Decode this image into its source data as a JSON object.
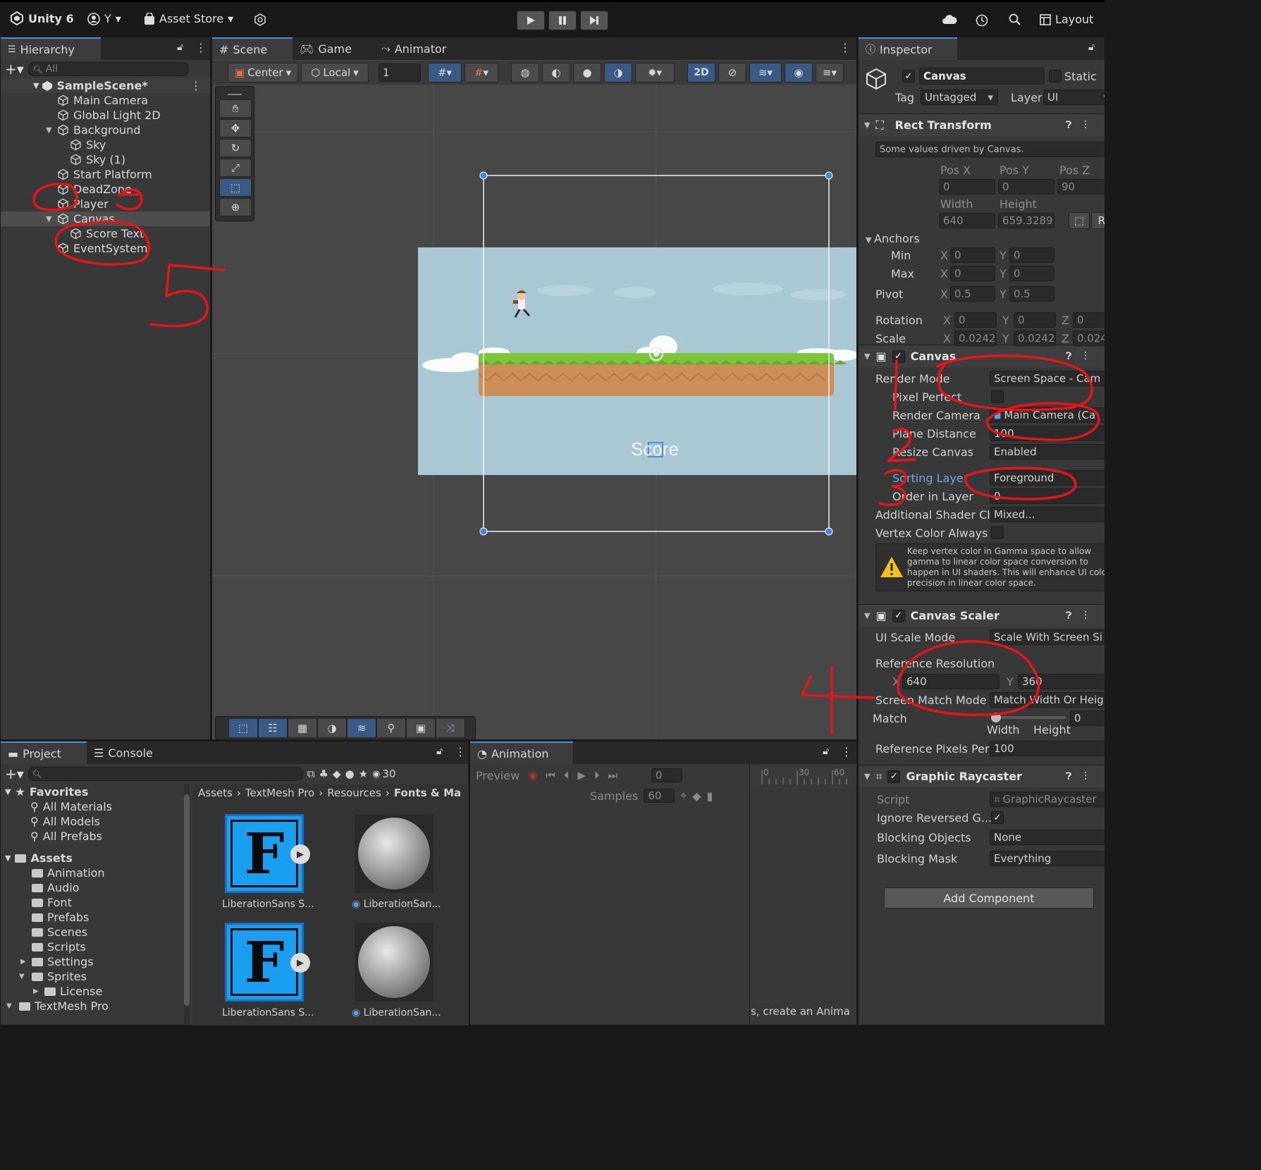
{
  "topbar": {
    "app_name": "Unity 6",
    "account": "Y",
    "asset_store": "Asset Store",
    "layout": "Layout"
  },
  "hierarchy": {
    "tab": "Hierarchy",
    "search_placeholder": "All",
    "scene": "SampleScene*",
    "items": [
      {
        "label": "Main Camera",
        "indent": 1
      },
      {
        "label": "Global Light 2D",
        "indent": 1
      },
      {
        "label": "Background",
        "indent": 1,
        "expanded": true
      },
      {
        "label": "Sky",
        "indent": 2
      },
      {
        "label": "Sky (1)",
        "indent": 2
      },
      {
        "label": "Start Platform",
        "indent": 1
      },
      {
        "label": "DeadZone",
        "indent": 1
      },
      {
        "label": "Player",
        "indent": 1
      },
      {
        "label": "Canvas",
        "indent": 1,
        "expanded": true,
        "selected": true
      },
      {
        "label": "Score Text",
        "indent": 2
      },
      {
        "label": "EventSystem",
        "indent": 1
      }
    ]
  },
  "scene_view": {
    "tabs": [
      "Scene",
      "Game",
      "Animator"
    ],
    "pivot": "Center",
    "space": "Local",
    "grid_value": "1",
    "mode_2d": "2D",
    "score_label": "Score"
  },
  "inspector": {
    "tab": "Inspector",
    "object_name": "Canvas",
    "static_label": "Static",
    "tag_label": "Tag",
    "tag_value": "Untagged",
    "layer_label": "Layer",
    "layer_value": "UI",
    "rect_transform": {
      "title": "Rect Transform",
      "note": "Some values driven by Canvas.",
      "pos_x_label": "Pos X",
      "pos_y_label": "Pos Y",
      "pos_z_label": "Pos Z",
      "pos_x": "0",
      "pos_y": "0",
      "pos_z": "90",
      "width_label": "Width",
      "height_label": "Height",
      "width": "640",
      "height": "659.3289",
      "anchors_label": "Anchors",
      "min_label": "Min",
      "max_label": "Max",
      "pivot_label": "Pivot",
      "min_x": "0",
      "min_y": "0",
      "max_x": "0",
      "max_y": "0",
      "pivot_x": "0.5",
      "pivot_y": "0.5",
      "rotation_label": "Rotation",
      "scale_label": "Scale",
      "rot_x": "0",
      "rot_y": "0",
      "rot_z": "0",
      "scale_x": "0.0242",
      "scale_y": "0.0242",
      "scale_z": "0.024",
      "x": "X",
      "y": "Y",
      "z": "Z"
    },
    "canvas": {
      "title": "Canvas",
      "render_mode_label": "Render Mode",
      "render_mode": "Screen Space - Cam",
      "pixel_perfect_label": "Pixel Perfect",
      "render_camera_label": "Render Camera",
      "render_camera": "Main Camera (Ca",
      "plane_distance_label": "Plane Distance",
      "plane_distance": "100",
      "resize_canvas_label": "Resize Canvas",
      "resize_canvas": "Enabled",
      "sorting_layer_label": "Sorting Layer",
      "sorting_layer": "Foreground",
      "order_label": "Order in Layer",
      "order": "0",
      "shader_label": "Additional Shader Ch",
      "shader": "Mixed...",
      "vertex_label": "Vertex Color Always",
      "warning": "Keep vertex color in Gamma space to allow gamma to linear color space conversion to happen in UI shaders. This will enhance UI color precision in linear color space."
    },
    "scaler": {
      "title": "Canvas Scaler",
      "mode_label": "UI Scale Mode",
      "mode": "Scale With Screen Si",
      "ref_label": "Reference Resolution",
      "ref_x": "640",
      "ref_y": "360",
      "match_mode_label": "Screen Match Mode",
      "match_mode": "Match Width Or Heig",
      "match_label": "Match",
      "match_value": "0",
      "match_fraction": 0,
      "width_label": "Width",
      "height_label": "Height",
      "ppu_label": "Reference Pixels Per",
      "ppu": "100",
      "x": "X",
      "y": "Y"
    },
    "raycaster": {
      "title": "Graphic Raycaster",
      "script_label": "Script",
      "script": "GraphicRaycaster",
      "ignore_label": "Ignore Reversed G...",
      "blocking_objects_label": "Blocking Objects",
      "blocking_objects": "None",
      "blocking_mask_label": "Blocking Mask",
      "blocking_mask": "Everything"
    },
    "add_component": "Add Component"
  },
  "project": {
    "tabs": [
      "Project",
      "Console"
    ],
    "count": "30",
    "favorites_label": "Favorites",
    "favorites": [
      "All Materials",
      "All Models",
      "All Prefabs"
    ],
    "assets_label": "Assets",
    "folders": [
      {
        "label": "Animation",
        "indent": 1
      },
      {
        "label": "Audio",
        "indent": 1
      },
      {
        "label": "Font",
        "indent": 1
      },
      {
        "label": "Prefabs",
        "indent": 1
      },
      {
        "label": "Scenes",
        "indent": 1
      },
      {
        "label": "Scripts",
        "indent": 1
      },
      {
        "label": "Settings",
        "indent": 1
      },
      {
        "label": "Sprites",
        "indent": 1
      },
      {
        "label": "License",
        "indent": 2
      },
      {
        "label": "TextMesh Pro",
        "indent": 0
      }
    ],
    "breadcrumb": [
      "Assets",
      "TextMesh Pro",
      "Resources",
      "Fonts & Ma"
    ],
    "assets": [
      "LiberationSans S...",
      "LiberationSan...",
      "LiberationSans S...",
      "LiberationSan..."
    ]
  },
  "animation": {
    "tab": "Animation",
    "preview": "Preview",
    "frame": "0",
    "samples_label": "Samples",
    "samples": "60",
    "timeline_ticks": [
      "0",
      "30",
      "60"
    ],
    "hint": "s, create an Anima"
  },
  "annotations_color": "#e8141a"
}
